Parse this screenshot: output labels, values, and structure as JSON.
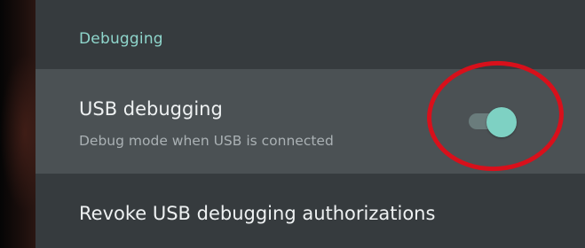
{
  "section": {
    "title": "Debugging"
  },
  "usb_debugging": {
    "title": "USB debugging",
    "summary": "Debug mode when USB is connected",
    "enabled": true
  },
  "revoke": {
    "title": "Revoke USB debugging authorizations"
  },
  "colors": {
    "accent": "#7ed1c3",
    "annotation": "#d8101b"
  }
}
